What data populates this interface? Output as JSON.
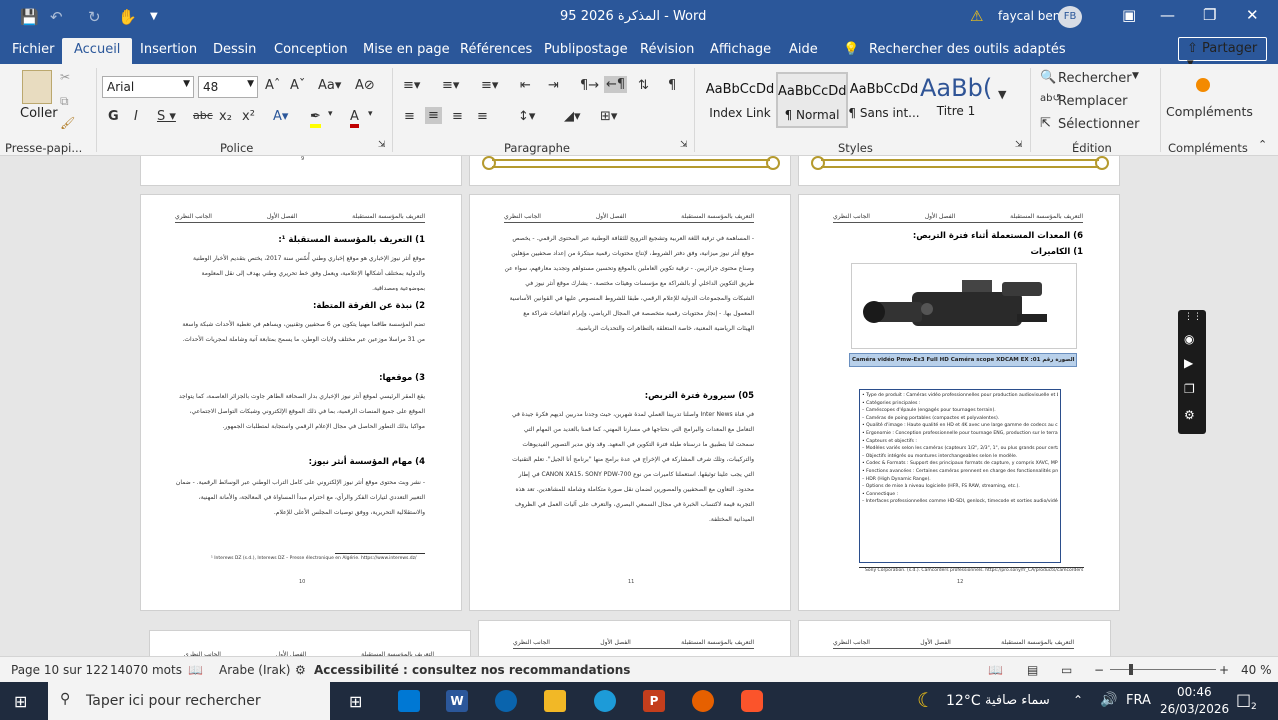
{
  "titlebar": {
    "title": "المذكرة 2026 95 - Word",
    "user": "faycal ben",
    "initials": "FB",
    "icons": [
      "save-icon",
      "undo-icon",
      "redo-icon",
      "touch-mode-icon",
      "customize-icon"
    ]
  },
  "tabs": [
    "Fichier",
    "Accueil",
    "Insertion",
    "Dessin",
    "Conception",
    "Mise en page",
    "Références",
    "Publipostage",
    "Révision",
    "Affichage",
    "Aide"
  ],
  "active_tab": "Accueil",
  "tell_me": "Rechercher des outils adaptés",
  "share_label": "Partager",
  "ribbon": {
    "paste_label": "Coller",
    "clipboard_label": "Presse-papi...",
    "police_label": "Police",
    "paragraphe_label": "Paragraphe",
    "styles_label": "Styles",
    "edition_label": "Édition",
    "complements_label": "Compléments",
    "font_name": "Arial",
    "font_size": "48",
    "styles": [
      {
        "preview": "AaBbCcDd",
        "name": "Index Link"
      },
      {
        "preview": "AaBbCcDd",
        "name": "¶ Normal"
      },
      {
        "preview": "AaBbCcDd",
        "name": "¶ Sans int..."
      },
      {
        "preview": "AaBb(",
        "name": "Titre 1"
      }
    ],
    "rechercher": "Rechercher",
    "remplacer": "Remplacer",
    "selectionner": "Sélectionner",
    "complements_btn": "Compléments"
  },
  "pages": {
    "left": {
      "header": [
        "الجانب النظري",
        "الفصل الأول",
        "التعريف بالمؤسسة المستقبلة"
      ],
      "h1": "1) التعريف بالمؤسسة المستقبلة ¹:",
      "p1": "موقع أنثر نيوز الإخباري هو موقع إخباري وطني أُسّس سنة 2017، يختص بتقديم الأخبار الوطنية والدولية بمختلف أشكالها الإعلامية، ويعمل وفق خط تحريري وطني يهدف إلى نقل المعلومة بموضوعية ومصداقية.",
      "h2": "2) نبذة عن الفرقة المتطة:",
      "p2": "تضم المؤسسة طاقما مهنيا يتكون من 6 صحفيين وتقنيين، ويساهم في تغطية الأحداث شبكة واسعة من 31 مراسلا موزعين عبر مختلف ولايات الوطن، ما يسمح بمتابعة آنية وشاملة لمجريات الأحداث.",
      "h3": "3) موقعها:",
      "p3": "يقع المقر الرئيسي لموقع أنثر نيوز الإخباري بدار الصحافة الطاهر جاوت بالجزائر العاصمة، كما يتواجد الموقع على جميع المنصات الرقمية، بما في ذلك الموقع الإلكتروني وشبكات التواصل الاجتماعي، مواكبا بذلك التطور الحاصل في مجال الإعلام الرقمي واستجابة لمتطلبات الجمهور.",
      "h4": "4) مهام المؤسسة أنثر نيوز:",
      "p4": "- نشر وبث محتوى موقع أنثر نيوز الإلكتروني على كامل التراب الوطني عبر الوسائط الرقمية. - ضمان التعبير التعددي لتيارات الفكر والرأي، مع احترام مبدأ المساواة في المعالجة، والأمانة المهنية، والاستقلالية التحريرية، ووفق توصيات المجلس الأعلى للإعلام.",
      "footnote": "¹ Interews DZ (s.d.), Interews DZ – Presse électronique en Algérie. https://www.interews.dz/",
      "num": "10"
    },
    "mid": {
      "header": [
        "الجانب النظري",
        "الفصل الأول",
        "التعريف بالمؤسسة المستقبلة"
      ],
      "p1": "- المساهمة في ترقية اللغة العربية وتشجيع الترويج للثقافة الوطنية عبر المحتوى الرقمي. - يخصص موقع أنثر نيوز ميزانية، وفق دفتر الشروط، لإنتاج محتويات رقمية مبتكرة من إعداد صحفيين مؤهلين وصناع محتوى جزائريين. - ترقية تكوين العاملين بالموقع وتحسين مستواهم وتجديد معارفهم، سواء عن طريق التكوين الداخلي أو بالشراكة مع مؤسسات وهيئات مختصة. - يشارك موقع أنثر نيوز في الشبكات والمجموعات الدولية للإعلام الرقمي، طبقا للشروط المنصوص عليها في القوانين الأساسية المعمول بها. - إنجاز محتويات رقمية متخصصة في المجال الرياضي، وإبرام اتفاقيات شراكة مع الهيئات الرياضية المعنية، خاصة المتعلقة بالتظاهرات والتحديات الرياضية.",
      "h": "05) سيرورة فترة التربص:",
      "p2": "في قناة Inter News واصلنا تدريبنا العملي لمدة شهرين، حيث وجدنا مدربين لديهم فكرة جيدة في التعامل مع المعدات والبرامج التي نحتاجها في مسارنا المهني، كما قمنا بالعديد من المهام التي سمحت لنا بتطبيق ما درسناه طيلة فترة التكوين في المعهد. وقد وثق مدير التصوير الفيديوهات والتركيبات، وتلك شرف المشاركة في الإخراج في عدة برامج منها \"برنامج أنا الجيل\". تعلم التقنيات التي يجب علينا توثيقها. استعملنا كاميرات من نوع CANON XA15، SONY PDW-700 في إطار محدود. التعاون مع الصحفيين والمصورين لضمان نقل صورة متكاملة وشاملة للمشاهدين. تعد هذه التجربة قيمة لاكتساب الخبرة في مجال السمعي البصري، والتعرف على آليات العمل في الظروف الميدانية المختلفة.",
      "num": "11"
    },
    "right": {
      "header": [
        "الجانب النظري",
        "الفصل الأول",
        "التعريف بالمؤسسة المستقبلة"
      ],
      "h1": "6) المعدات المستعملة أثناء فترة التربص:",
      "h2": "1) الكاميرات",
      "caption": "Caméra vidéo Pmw-Ex3 Full HD Caméra scope XDCAM EX :01 الصورة رقم",
      "box": [
        "• Type de produit : Caméras vidéo professionnelles pour production audiovisuelle et broadcast.",
        "• Catégories principales :",
        "– Caméscopes d'épaule (engagés pour tournages terrain).",
        "– Caméras de poing portables (compactes et polyvalentes).",
        "• Qualité d'image : Haute qualité en HD et 4K avec une large gamme de codecs au choix.",
        "• Ergonomie : Conception professionnelle pour tournage ENG, production sur le terrain et intégration facile en workflows broadcast.",
        "• Capteurs et objectifs :",
        "– Modèles variés selon les caméras (capteurs 1/2\", 2/3\", 1\", ou plus grands pour certaines gammes).",
        "– Objectifs intégrés ou montures interchangeables selon le modèle.",
        "• Codec & Formats : Support des principaux formats de capture, y compris XAVC, MPEG HD, MPEG-2 et autres options broadcast selon modèle.",
        "• Fonctions avancées : Certaines caméras prennent en charge des fonctionnalités professionnelles telles que :",
        "– HDR (High Dynamic Range).",
        "– Options de mise à niveau logicielle (HFR, FS RAW, streaming, etc.).",
        "• Connectique :",
        "– Interfaces professionnelles comme HD-SDI, genlock, timecode et sorties audio/vidéo variables selon modèle."
      ],
      "footnote": "Sony Corporation. (s.d.). Camcorders professionnels. https://pro.sony/fr_CA/products/camcorders",
      "num": "12"
    },
    "top_page_num": "9"
  },
  "statusbar": {
    "page": "Page 10 sur 122",
    "words": "14070 mots",
    "language": "Arabe (Irak)",
    "accessibility": "Accessibilité : consultez nos recommandations",
    "zoom": "40 %"
  },
  "taskbar": {
    "search_placeholder": "Taper ici pour rechercher",
    "temp": "12°C",
    "weather": "سماء صافية",
    "lang": "FRA",
    "time": "00:46",
    "date": "26/03/2026",
    "notif": "2"
  }
}
